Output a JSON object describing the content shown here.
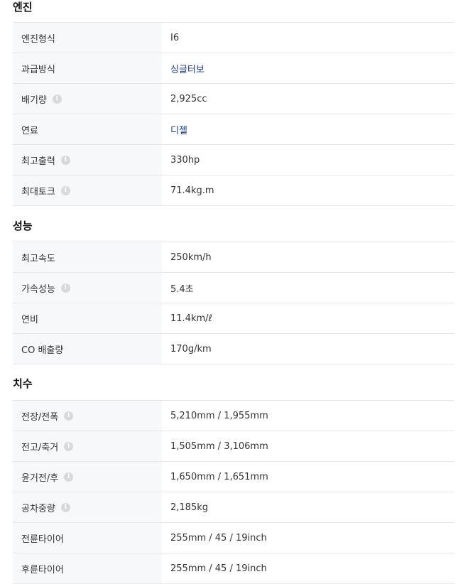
{
  "sections": [
    {
      "title": "엔진",
      "rows": [
        {
          "label": "엔진형식",
          "value": "I6",
          "info": false,
          "link": false
        },
        {
          "label": "과급방식",
          "value": "싱글터보",
          "info": false,
          "link": true
        },
        {
          "label": "배기량",
          "value": "2,925cc",
          "info": true,
          "link": false
        },
        {
          "label": "연료",
          "value": "디젤",
          "info": false,
          "link": true
        },
        {
          "label": "최고출력",
          "value": "330hp",
          "info": true,
          "link": false
        },
        {
          "label": "최대토크",
          "value": "71.4kg.m",
          "info": true,
          "link": false
        }
      ]
    },
    {
      "title": "성능",
      "rows": [
        {
          "label": "최고속도",
          "value": "250km/h",
          "info": false,
          "link": false
        },
        {
          "label": "가속성능",
          "value": "5.4초",
          "info": true,
          "link": false
        },
        {
          "label": "연비",
          "value": "11.4km/ℓ",
          "info": false,
          "link": false
        },
        {
          "label": "CO 배출량",
          "value": "170g/km",
          "info": false,
          "link": false
        }
      ]
    },
    {
      "title": "치수",
      "rows": [
        {
          "label": "전장/전폭",
          "value": "5,210mm / 1,955mm",
          "info": true,
          "link": false
        },
        {
          "label": "전고/축거",
          "value": "1,505mm / 3,106mm",
          "info": true,
          "link": false
        },
        {
          "label": "윤거전/후",
          "value": "1,650mm / 1,651mm",
          "info": true,
          "link": false
        },
        {
          "label": "공차중량",
          "value": "2,185kg",
          "info": true,
          "link": false
        },
        {
          "label": "전륜타이어",
          "value": "255mm / 45 / 19inch",
          "info": false,
          "link": false
        },
        {
          "label": "후륜타이어",
          "value": "255mm / 45 / 19inch",
          "info": false,
          "link": false
        }
      ]
    }
  ],
  "info_icon_glyph": "i",
  "colors": {
    "link": "#1c3f94",
    "label_bg": "#f7f8fa",
    "border": "#e6e6e6"
  }
}
